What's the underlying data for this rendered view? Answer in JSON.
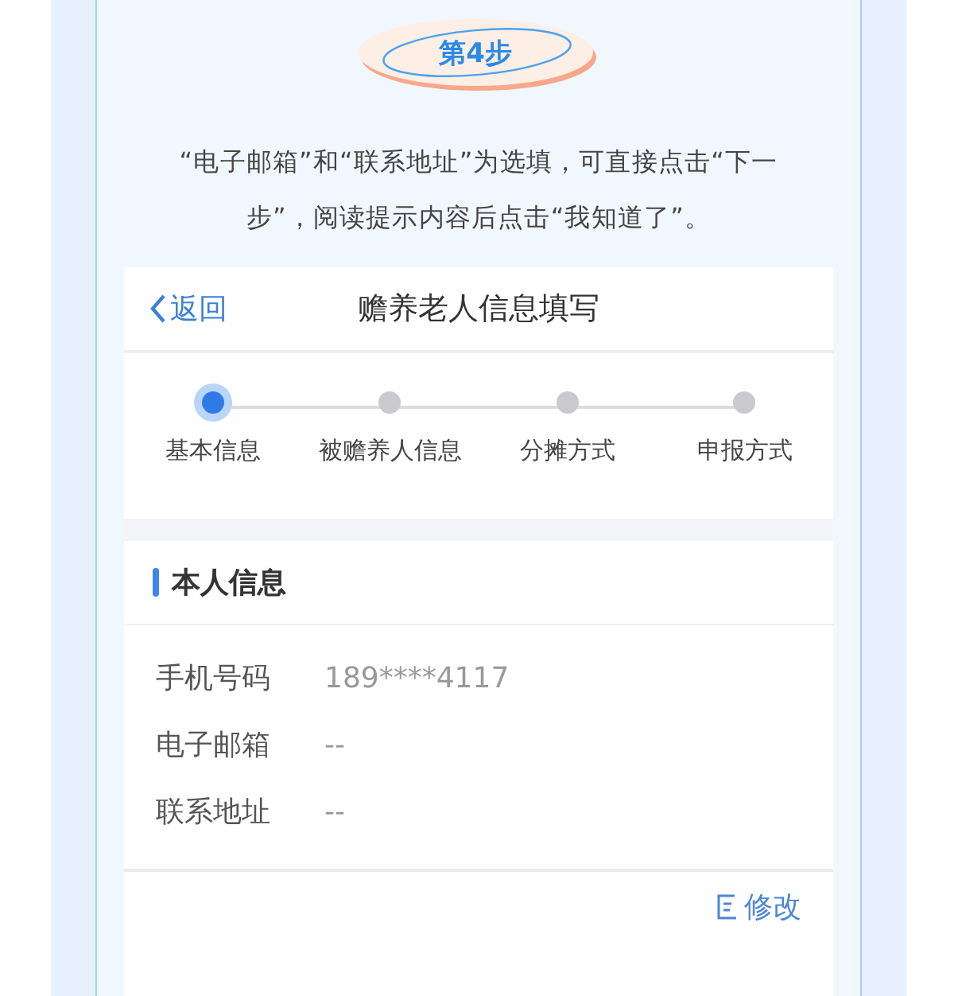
{
  "step_badge": {
    "label": "第4步"
  },
  "instruction": "“电子邮箱”和“联系地址”为选填，可直接点击“下一步”，阅读提示内容后点击“我知道了”。",
  "phone": {
    "nav": {
      "back": "返回",
      "title": "赡养老人信息填写"
    },
    "steps": [
      {
        "label": "基本信息",
        "selected": true
      },
      {
        "label": "被赡养人信息",
        "selected": false
      },
      {
        "label": "分摊方式",
        "selected": false
      },
      {
        "label": "申报方式",
        "selected": false
      }
    ],
    "section": {
      "title": "本人信息",
      "fields": [
        {
          "label": "手机号码",
          "value": "189****4117"
        },
        {
          "label": "电子邮箱",
          "value": "--"
        },
        {
          "label": "联系地址",
          "value": "--"
        }
      ]
    },
    "edit_link": "修改"
  }
}
